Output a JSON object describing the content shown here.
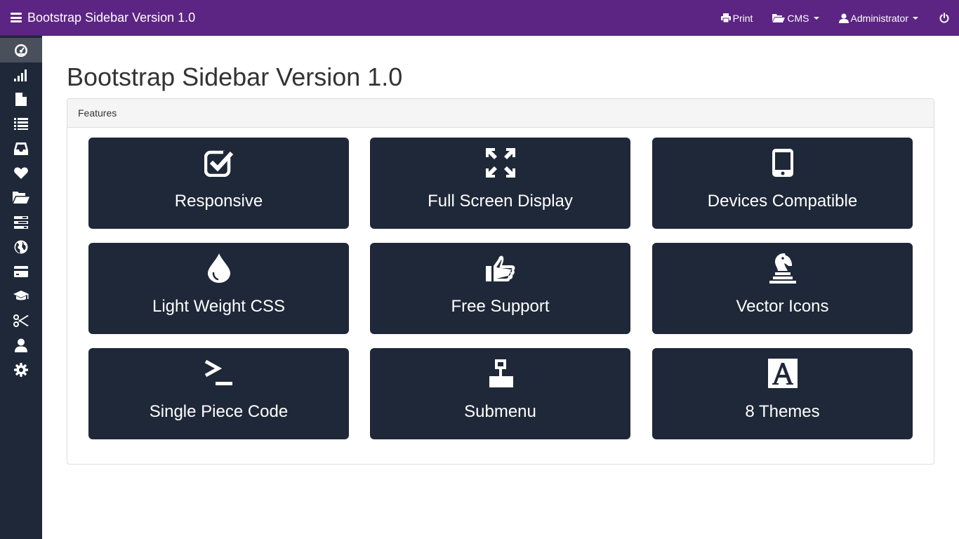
{
  "navbar": {
    "brand": "Bootstrap Sidebar Version 1.0",
    "print": "Print",
    "cms": "CMS",
    "user": "Administrator",
    "bg_color": "#5c2483"
  },
  "sidebar": {
    "bg_color": "#1f2838",
    "items": [
      {
        "icon": "dashboard-icon",
        "active": true
      },
      {
        "icon": "signal-icon",
        "active": false
      },
      {
        "icon": "file-icon",
        "active": false
      },
      {
        "icon": "list-icon",
        "active": false
      },
      {
        "icon": "inbox-icon",
        "active": false
      },
      {
        "icon": "heart-icon",
        "active": false
      },
      {
        "icon": "folder-open-icon",
        "active": false
      },
      {
        "icon": "tasks-icon",
        "active": false
      },
      {
        "icon": "globe-icon",
        "active": false
      },
      {
        "icon": "credit-card-icon",
        "active": false
      },
      {
        "icon": "graduation-cap-icon",
        "active": false
      },
      {
        "icon": "scissors-icon",
        "active": false
      },
      {
        "icon": "user-icon",
        "active": false
      },
      {
        "icon": "settings-icon",
        "active": false
      }
    ]
  },
  "main": {
    "title": "Bootstrap Sidebar Version 1.0",
    "panel_heading": "Features",
    "features": [
      {
        "label": "Responsive",
        "icon": "check-square-icon"
      },
      {
        "label": "Full Screen Display",
        "icon": "fullscreen-icon"
      },
      {
        "label": "Devices Compatible",
        "icon": "mobile-icon"
      },
      {
        "label": "Light Weight CSS",
        "icon": "tint-icon"
      },
      {
        "label": "Free Support",
        "icon": "thumbs-up-icon"
      },
      {
        "label": "Vector Icons",
        "icon": "chess-knight-icon"
      },
      {
        "label": "Single Piece Code",
        "icon": "terminal-icon"
      },
      {
        "label": "Submenu",
        "icon": "sitemap-icon"
      },
      {
        "label": "8 Themes",
        "icon": "font-icon"
      }
    ],
    "tile_color": "#1f2838"
  }
}
